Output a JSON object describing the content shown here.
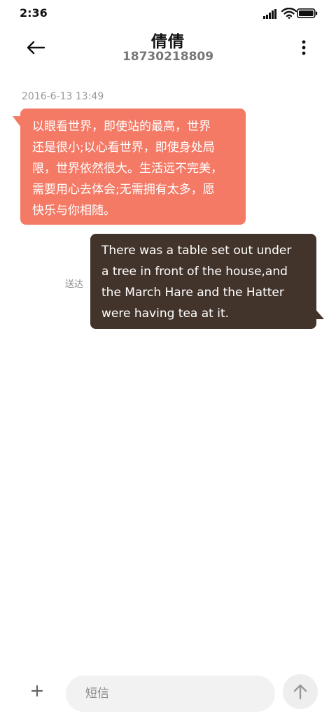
{
  "status_bar": {
    "time": "2:36",
    "icons": [
      "signal-icon",
      "wifi-icon",
      "battery-icon"
    ]
  },
  "header": {
    "back_icon": "arrow-left-icon",
    "contact_name": "倩倩",
    "contact_number": "18730218809",
    "more_icon": "more-vertical-icon"
  },
  "conversation": {
    "timestamp": "2016-6-13 13:49",
    "incoming_message": {
      "lines": [
        "以眼看世界，即使站的最高，世界",
        "还是很小;以心看世界，即使身处局",
        "限，世界依然很大。生活远不完美，",
        "需要用心去体会;无需拥有太多，愿",
        "快乐与你相随。"
      ],
      "bubble_color": "#f47a66"
    },
    "outgoing_message": {
      "lines": [
        "There was a table set out under",
        "a tree in front of the house,and",
        "the March Hare and the Hatter",
        "were having tea at it."
      ],
      "status": "送达",
      "bubble_color": "#43342b"
    }
  },
  "compose": {
    "attach_icon": "plus-icon",
    "placeholder": "短信",
    "send_icon": "arrow-up-icon"
  }
}
